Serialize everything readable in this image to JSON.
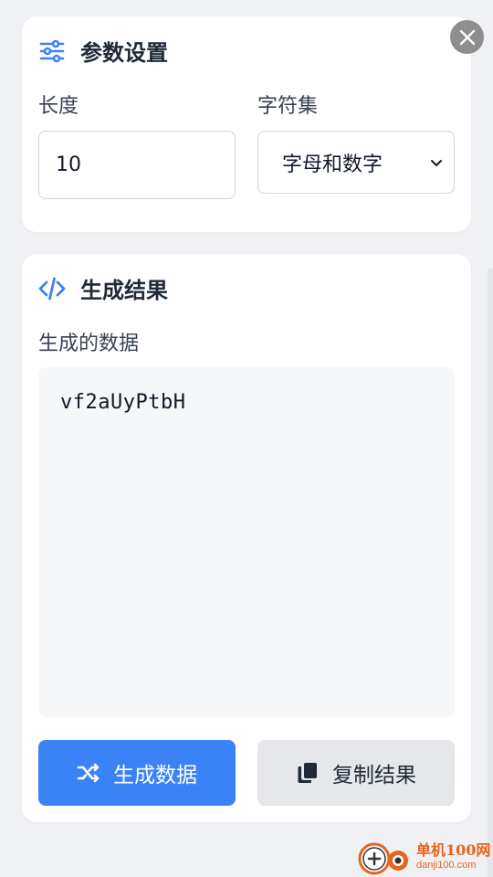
{
  "params_card": {
    "title": "参数设置",
    "length_label": "长度",
    "length_value": "10",
    "charset_label": "字符集",
    "charset_selected": "字母和数字"
  },
  "result_card": {
    "title": "生成结果",
    "output_label": "生成的数据",
    "output_value": "vf2aUyPtbH"
  },
  "actions": {
    "generate_label": "生成数据",
    "copy_label": "复制结果"
  },
  "watermark": {
    "main": "单机100网",
    "sub": "danji100.com"
  },
  "colors": {
    "accent": "#3b82f6",
    "page_bg": "#f0f1f4",
    "card_bg": "#ffffff",
    "output_bg": "#f6f7f9",
    "secondary_button": "#e5e7eb",
    "close_button": "#8e8e8e",
    "watermark": "#e8641b"
  },
  "icons": {
    "params_title": "sliders-icon",
    "result_title": "code-icon",
    "generate": "shuffle-icon",
    "copy": "copy-icon",
    "close": "close-icon",
    "select": "chevron-down-icon"
  }
}
